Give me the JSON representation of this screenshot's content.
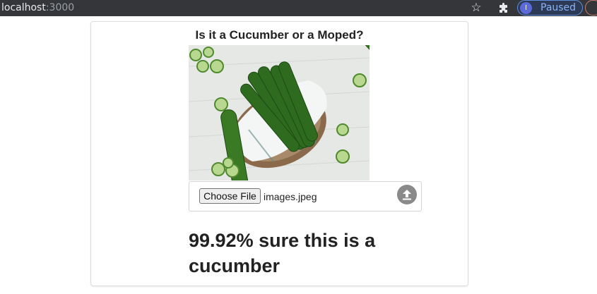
{
  "browser": {
    "url_host": "localhost",
    "url_port": ":3000",
    "star_icon": "star-icon",
    "extensions_icon": "puzzle-icon",
    "profile_initial": "I",
    "profile_status": "Paused"
  },
  "page": {
    "title": "Is it a Cucumber or a Moped?",
    "photo_icon": "cucumber-photo",
    "upload": {
      "choose_label": "Choose File",
      "file_name": "images.jpeg",
      "icon": "upload-icon"
    },
    "result_text": "99.92% sure this is a cucumber"
  },
  "colors": {
    "browser_bar": "#35363a",
    "profile_text": "#8ab4f8",
    "text": "#222222"
  }
}
